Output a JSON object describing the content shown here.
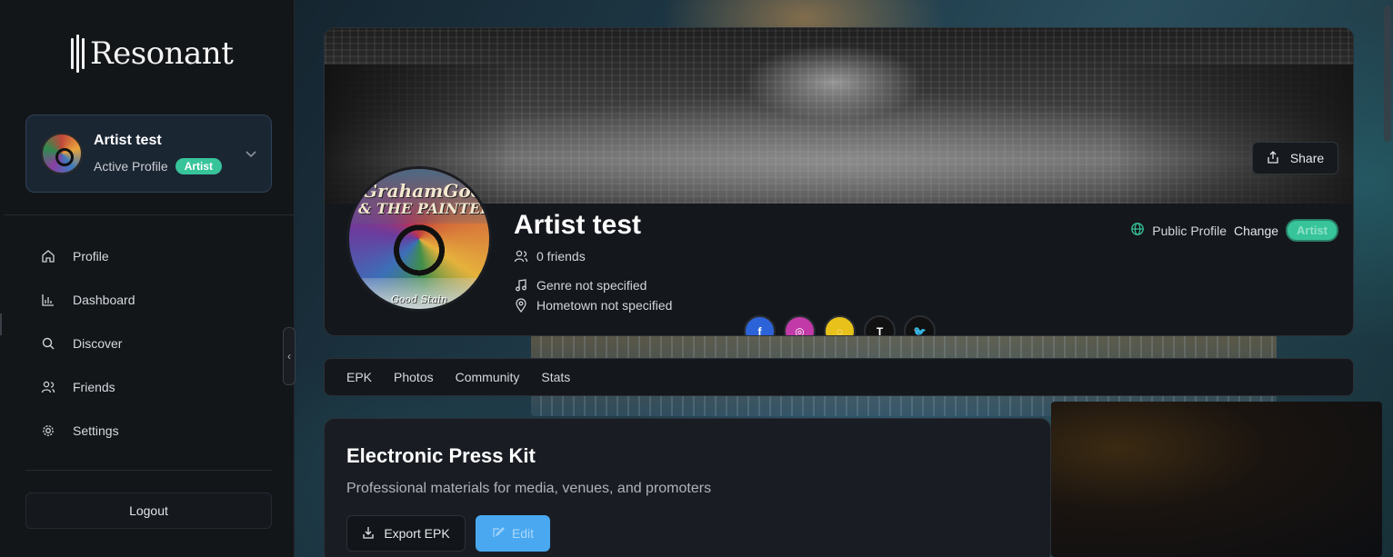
{
  "brand": {
    "name": "Resonant"
  },
  "profile_card": {
    "name": "Artist test",
    "status": "Active Profile",
    "role_badge": "Artist"
  },
  "nav": {
    "items": [
      {
        "label": "Profile",
        "icon": "home-icon"
      },
      {
        "label": "Dashboard",
        "icon": "bar-chart-icon"
      },
      {
        "label": "Discover",
        "icon": "search-icon"
      },
      {
        "label": "Friends",
        "icon": "users-icon"
      },
      {
        "label": "Settings",
        "icon": "gear-icon"
      }
    ]
  },
  "logout_label": "Logout",
  "header": {
    "share_label": "Share",
    "artist_name": "Artist test",
    "friends": "0 friends",
    "genre": "Genre not specified",
    "hometown": "Hometown not specified",
    "visibility": "Public Profile",
    "change_label": "Change",
    "role_badge": "Artist",
    "avatar_text": {
      "line1": "GrahamGood",
      "line2": "& THE PAINTERS",
      "line3": "Good Stain"
    }
  },
  "socials": [
    {
      "name": "facebook-icon",
      "glyph": "f",
      "color": "#2d63d8"
    },
    {
      "name": "instagram-icon",
      "glyph": "◎",
      "color": "#c23aa8"
    },
    {
      "name": "snapchat-icon",
      "glyph": "◌",
      "color": "#e8c21a"
    },
    {
      "name": "tiktok-icon",
      "glyph": "T",
      "color": "#111111"
    },
    {
      "name": "twitter-icon",
      "glyph": "🐦",
      "color": "#111111"
    }
  ],
  "tabs": [
    "EPK",
    "Photos",
    "Community",
    "Stats"
  ],
  "epk": {
    "title": "Electronic Press Kit",
    "subtitle": "Professional materials for media, venues, and promoters",
    "export_label": "Export EPK",
    "edit_label": "Edit"
  },
  "colors": {
    "accent_green": "#37c49a",
    "accent_blue": "#4aa8f0",
    "sidebar_bg": "#131619",
    "card_bg": "#14171c"
  }
}
